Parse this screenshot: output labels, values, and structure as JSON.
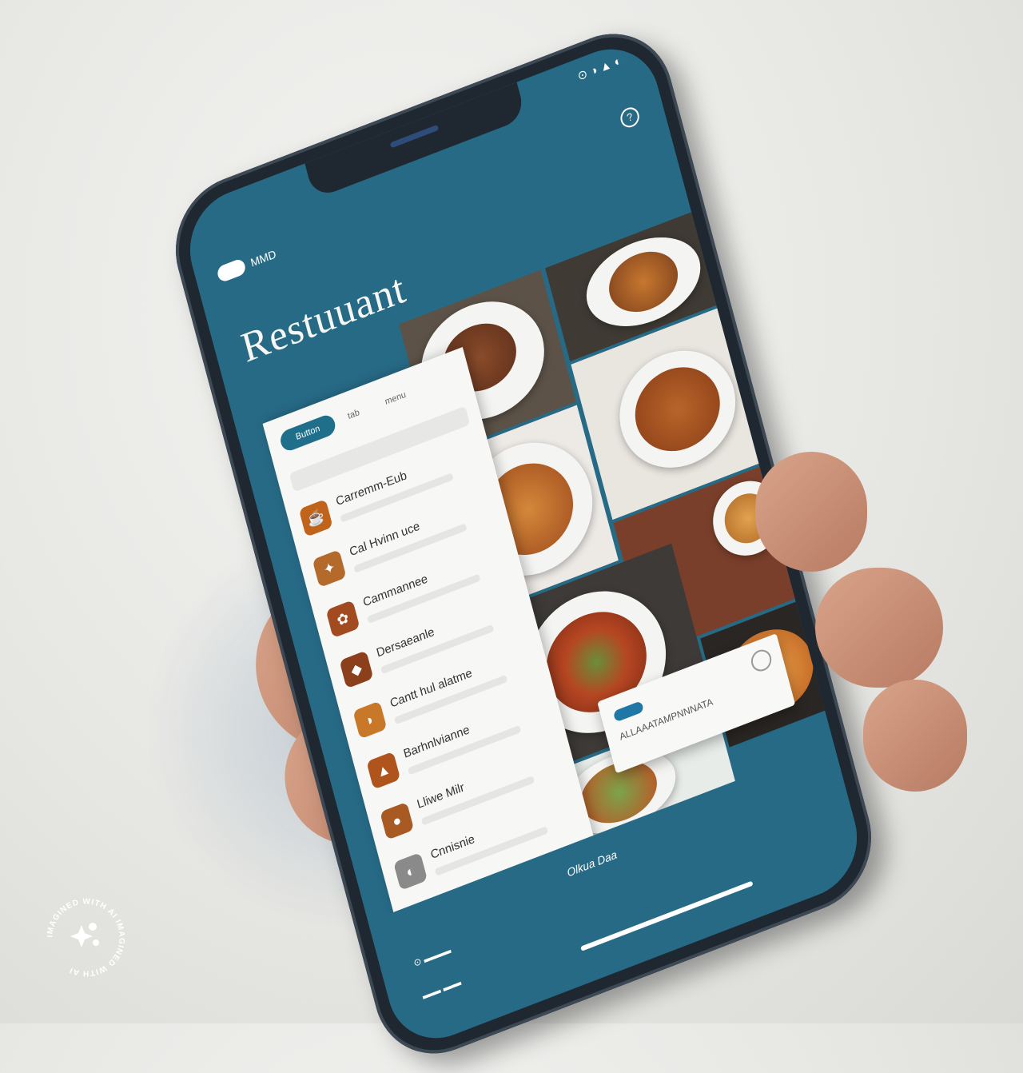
{
  "app": {
    "title": "Restuuant",
    "topbar_label": "MMD",
    "help_icon": "?"
  },
  "status": {
    "left": "",
    "right": "⊙ ◑ ▲ ◐"
  },
  "list_header": {
    "button": "Button",
    "tab_a": "tab",
    "tab_b": "menu"
  },
  "list_items": [
    {
      "label": "Carremm-Eub",
      "icon": "☕",
      "color": "#c0641b"
    },
    {
      "label": "Cal Hvinn uce",
      "icon": "✦",
      "color": "#b36a2b"
    },
    {
      "label": "Cammannee",
      "icon": "✿",
      "color": "#a24b20"
    },
    {
      "label": "Dersaeanle",
      "icon": "◆",
      "color": "#8c3f1b"
    },
    {
      "label": "Cantt hul alatme",
      "icon": "◗",
      "color": "#c87828"
    },
    {
      "label": "Barhnlvianne",
      "icon": "▲",
      "color": "#b0541e"
    },
    {
      "label": "Lliwe Milr",
      "icon": "●",
      "color": "#a85a22"
    },
    {
      "label": "Cnnisnie",
      "icon": "◐",
      "color": "#8a8a8a"
    }
  ],
  "overlay": {
    "text": "ALLAAATAMPNNNATA"
  },
  "bottom": {
    "center": "Olkua Daa",
    "row1": "⊙ ▬▬▬",
    "row2": "▬▬ ▬▬"
  },
  "badge": {
    "text": "IMAGINED WITH AI IMAGINED WITH AI"
  },
  "colors": {
    "primary": "#276a86",
    "accent": "#1f6f8b",
    "panel": "#f7f7f6"
  }
}
